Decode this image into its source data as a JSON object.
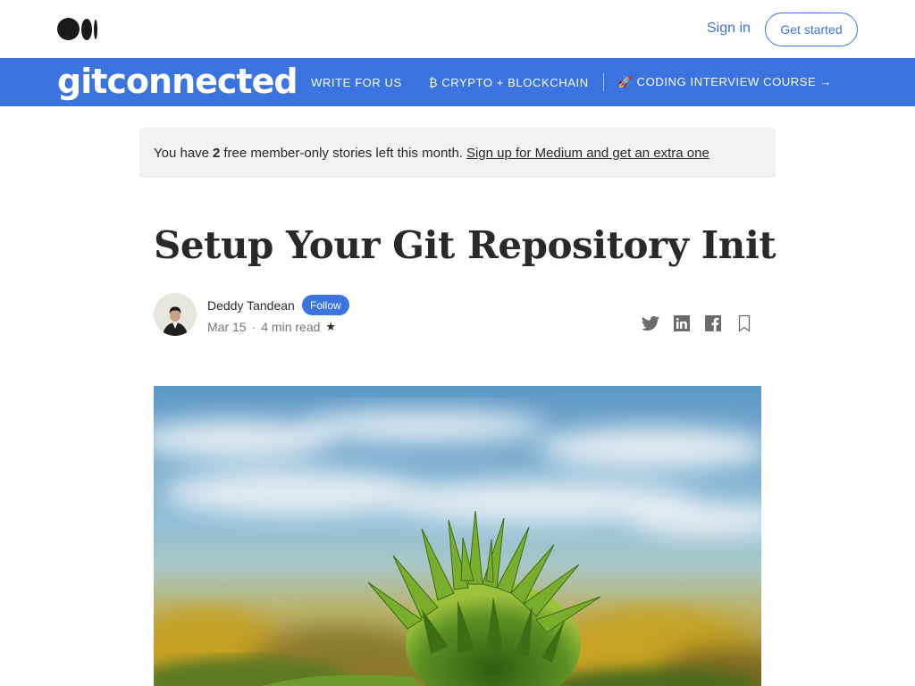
{
  "header": {
    "sign_in_label": "Sign in",
    "get_started_label": "Get started"
  },
  "publication": {
    "name": "gitconnected",
    "nav": [
      {
        "label": "WRITE FOR US"
      },
      {
        "label": "₿ CRYPTO + BLOCKCHAIN"
      },
      {
        "label": "🚀 CODING INTERVIEW COURSE →"
      }
    ]
  },
  "banner": {
    "prefix": "You have",
    "count": "2",
    "suffix": "free member-only stories left this month.",
    "link_label": "Sign up for Medium and get an extra one"
  },
  "article": {
    "title": "Setup Your Git Repository Init",
    "author": "Deddy Tandean",
    "follow_label": "Follow",
    "date": "Mar 15",
    "separator": "·",
    "read_time": "4 min read",
    "member_star": "★"
  },
  "share_icons": [
    "twitter-icon",
    "linkedin-icon",
    "facebook-icon",
    "bookmark-icon"
  ],
  "colors": {
    "brand_blue": "#3b73e0",
    "banner_bg": "#f2f2f2",
    "text": "#292929",
    "muted": "#757575"
  }
}
